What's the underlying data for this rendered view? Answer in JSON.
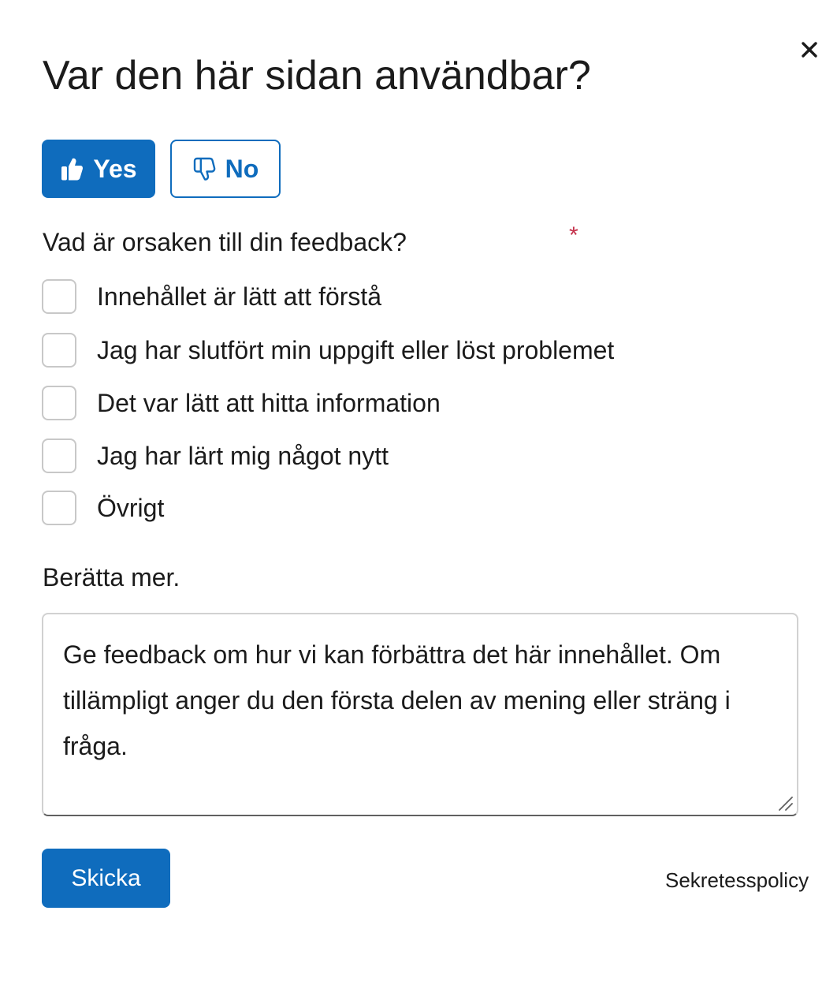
{
  "dialog": {
    "title": "Var den här sidan användbar?",
    "close_icon": "close-icon"
  },
  "vote": {
    "yes_label": "Yes",
    "yes_icon": "thumbs-up-icon",
    "no_label": "No",
    "no_icon": "thumbs-down-icon"
  },
  "reason": {
    "question": "Vad är orsaken till din feedback?",
    "required_mark": "*",
    "options": [
      {
        "label": "Innehållet är lätt att förstå"
      },
      {
        "label": "Jag har slutfört min uppgift eller löst problemet"
      },
      {
        "label": "Det var lätt att hitta information"
      },
      {
        "label": "Jag har lärt mig något nytt"
      },
      {
        "label": "Övrigt"
      }
    ]
  },
  "details": {
    "label": "Berätta mer.",
    "placeholder": "Ge feedback om hur vi kan förbättra det här innehållet. Om tillämpligt anger du den första delen av mening eller sträng i fråga."
  },
  "footer": {
    "submit_label": "Skicka",
    "privacy_label": "Sekretesspolicy"
  },
  "colors": {
    "accent": "#0f6cbd",
    "required": "#c4314b",
    "text": "#1b1b1b",
    "checkbox_border": "#c8c8c8"
  }
}
